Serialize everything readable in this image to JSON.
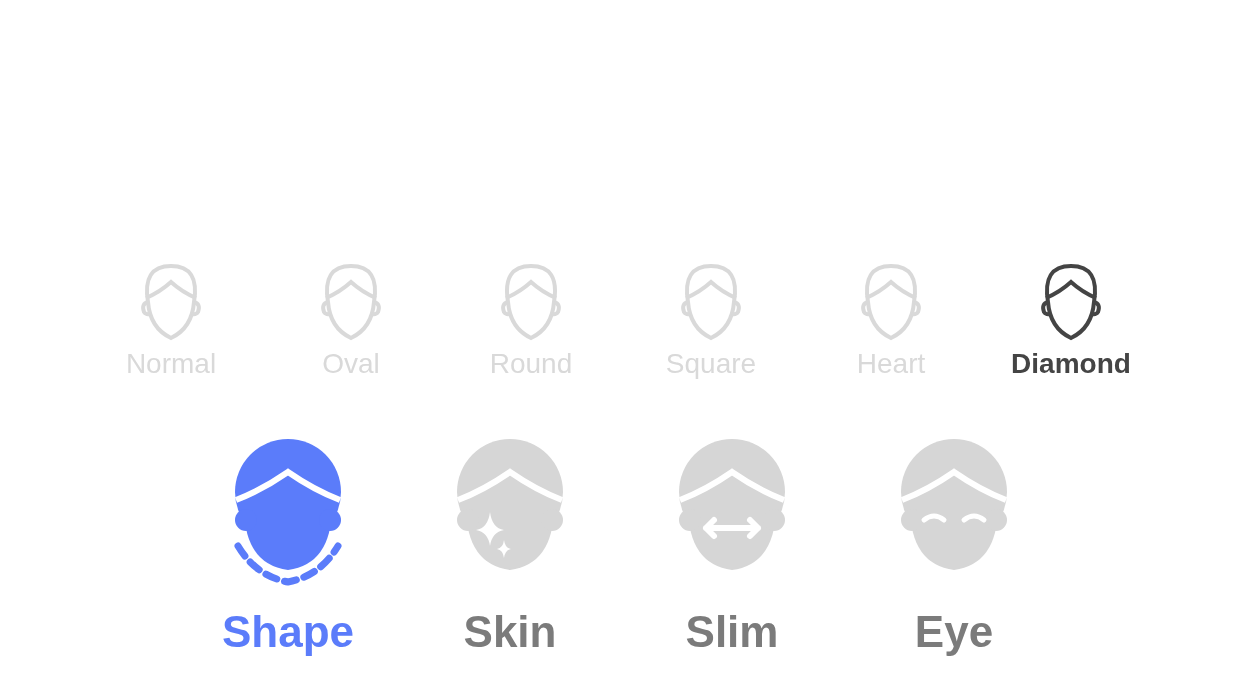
{
  "face_shapes": [
    {
      "label": "Normal",
      "selected": false
    },
    {
      "label": "Oval",
      "selected": false
    },
    {
      "label": "Round",
      "selected": false
    },
    {
      "label": "Square",
      "selected": false
    },
    {
      "label": "Heart",
      "selected": false
    },
    {
      "label": "Diamond",
      "selected": true
    }
  ],
  "tabs": [
    {
      "label": "Shape",
      "kind": "shape",
      "selected": true
    },
    {
      "label": "Skin",
      "kind": "skin",
      "selected": false
    },
    {
      "label": "Slim",
      "kind": "slim",
      "selected": false
    },
    {
      "label": "Eye",
      "kind": "eye",
      "selected": false
    }
  ]
}
